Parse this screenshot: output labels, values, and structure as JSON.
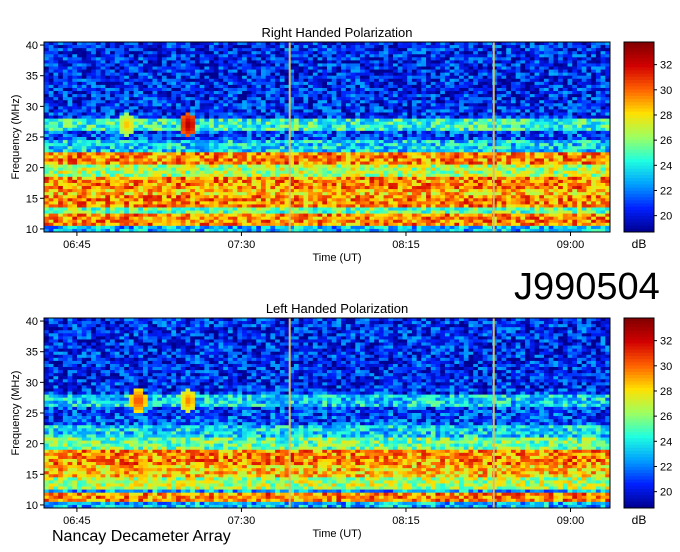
{
  "figure": {
    "observation_id": "J990504",
    "credit": "Nancay Decameter Array"
  },
  "colors": {
    "colormap": [
      "#00008f",
      "#0020ff",
      "#00a0ff",
      "#20ffdf",
      "#9fff60",
      "#ffe000",
      "#ff6000",
      "#d00000",
      "#800000"
    ]
  },
  "chart_data": [
    {
      "type": "heatmap",
      "title": "Right Handed Polarization",
      "xlabel": "Time (UT)",
      "ylabel": "Frequency (MHz)",
      "x_ticks": [
        "06:45",
        "07:30",
        "08:15",
        "09:00"
      ],
      "x_tick_hours": [
        6.75,
        7.5,
        8.25,
        9.0
      ],
      "xlim_hours": [
        6.6,
        9.18
      ],
      "y_ticks": [
        10,
        15,
        20,
        25,
        30,
        35,
        40
      ],
      "ylim": [
        9.5,
        40.5
      ],
      "colorbar": {
        "label": "dB",
        "ticks": [
          20,
          22,
          24,
          26,
          28,
          30,
          32
        ],
        "range": [
          18.7,
          33.8
        ]
      },
      "vertical_marker_hours": [
        7.72,
        8.65
      ],
      "bands": [
        {
          "f_min": 11.0,
          "f_max": 12.0,
          "level": 31
        },
        {
          "f_min": 12.5,
          "f_max": 13.5,
          "level": 27
        },
        {
          "f_min": 14.0,
          "f_max": 15.0,
          "level": 31
        },
        {
          "f_min": 15.5,
          "f_max": 16.5,
          "level": 30
        },
        {
          "f_min": 17.0,
          "f_max": 18.0,
          "level": 31
        },
        {
          "f_min": 18.5,
          "f_max": 20.0,
          "level": 28
        },
        {
          "f_min": 21.0,
          "f_max": 22.0,
          "level": 31
        },
        {
          "f_min": 22.5,
          "f_max": 24.0,
          "level": 25
        },
        {
          "f_min": 26.5,
          "f_max": 27.5,
          "level": 26
        }
      ],
      "hotspots": [
        {
          "hour": 7.26,
          "mhz": 27.0,
          "level": 33
        },
        {
          "hour": 6.98,
          "mhz": 27.0,
          "level": 29
        }
      ]
    },
    {
      "type": "heatmap",
      "title": "Left Handed Polarization",
      "xlabel": "Time (UT)",
      "ylabel": "Frequency (MHz)",
      "x_ticks": [
        "06:45",
        "07:30",
        "08:15",
        "09:00"
      ],
      "x_tick_hours": [
        6.75,
        7.5,
        8.25,
        9.0
      ],
      "xlim_hours": [
        6.6,
        9.18
      ],
      "y_ticks": [
        10,
        15,
        20,
        25,
        30,
        35,
        40
      ],
      "ylim": [
        9.5,
        40.5
      ],
      "colorbar": {
        "label": "dB",
        "ticks": [
          20,
          22,
          24,
          26,
          28,
          30,
          32
        ],
        "range": [
          18.7,
          33.8
        ]
      },
      "vertical_marker_hours": [
        7.72,
        8.65
      ],
      "bands": [
        {
          "f_min": 11.0,
          "f_max": 11.8,
          "level": 31
        },
        {
          "f_min": 13.0,
          "f_max": 14.0,
          "level": 28
        },
        {
          "f_min": 15.0,
          "f_max": 16.0,
          "level": 30
        },
        {
          "f_min": 17.0,
          "f_max": 18.5,
          "level": 31
        },
        {
          "f_min": 19.5,
          "f_max": 20.5,
          "level": 27
        },
        {
          "f_min": 21.5,
          "f_max": 22.5,
          "level": 25
        },
        {
          "f_min": 26.5,
          "f_max": 27.5,
          "level": 25
        }
      ],
      "hotspots": [
        {
          "hour": 7.03,
          "mhz": 27.0,
          "level": 31
        },
        {
          "hour": 7.26,
          "mhz": 27.0,
          "level": 30
        }
      ]
    }
  ]
}
